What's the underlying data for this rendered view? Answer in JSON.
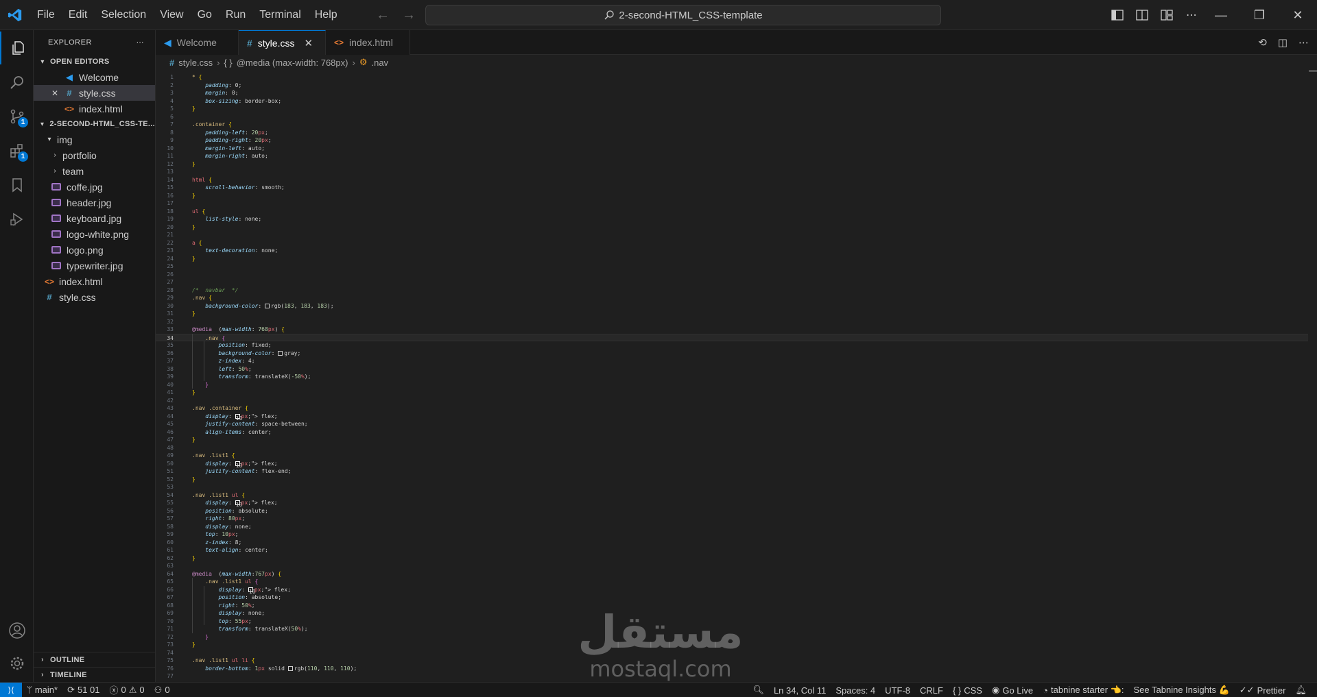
{
  "menu": [
    "File",
    "Edit",
    "Selection",
    "View",
    "Go",
    "Run",
    "Terminal",
    "Help"
  ],
  "command_center": {
    "text": "2-second-HTML_CSS-template"
  },
  "explorer": {
    "title": "EXPLORER",
    "open_editors_label": "OPEN EDITORS",
    "open_editors": [
      {
        "name": "Welcome",
        "icon": "vscode-icon"
      },
      {
        "name": "style.css",
        "icon": "css-icon",
        "close": "✕"
      },
      {
        "name": "index.html",
        "icon": "html-icon"
      }
    ],
    "project_label": "2-SECOND-HTML_CSS-TE...",
    "tree": [
      {
        "name": "img",
        "kind": "folder-open"
      },
      {
        "name": "portfolio",
        "kind": "folder"
      },
      {
        "name": "team",
        "kind": "folder"
      },
      {
        "name": "coffe.jpg",
        "kind": "image"
      },
      {
        "name": "header.jpg",
        "kind": "image"
      },
      {
        "name": "keyboard.jpg",
        "kind": "image"
      },
      {
        "name": "logo-white.png",
        "kind": "image"
      },
      {
        "name": "logo.png",
        "kind": "image"
      },
      {
        "name": "typewriter.jpg",
        "kind": "image"
      },
      {
        "name": "index.html",
        "kind": "html"
      },
      {
        "name": "style.css",
        "kind": "css"
      }
    ],
    "outline_label": "OUTLINE",
    "timeline_label": "TIMELINE"
  },
  "badges": {
    "source_control": "1",
    "extensions": "1"
  },
  "tabs": [
    {
      "label": "Welcome",
      "icon": "vscode-icon"
    },
    {
      "label": "style.css",
      "icon": "css-icon",
      "close": "✕"
    },
    {
      "label": "index.html",
      "icon": "html-icon"
    }
  ],
  "breadcrumb": {
    "file": "style.css",
    "media": "@media (max-width: 768px)",
    "symbol": ".nav"
  },
  "code": [
    "* {",
    "    padding: 0;",
    "    margin: 0;",
    "    box-sizing: border-box;",
    "}",
    "",
    ".container {",
    "    padding-left: 20px;",
    "    padding-right: 20px;",
    "    margin-left: auto;",
    "    margin-right: auto;",
    "}",
    "",
    "html {",
    "    scroll-behavior: smooth;",
    "}",
    "",
    "ul {",
    "    list-style: none;",
    "}",
    "",
    "a {",
    "    text-decoration: none;",
    "}",
    "",
    "",
    "",
    "/*  navbar  */",
    ".nav {",
    "    background-color: ▢rgb(183, 183, 183);",
    "}",
    "",
    "@media (max-width: 768px) {",
    "    .nav {",
    "        position: fixed;",
    "        background-color: ▢gray;",
    "        z-index: 4;",
    "        left: 50%;",
    "        transform: translateX(-50%);",
    "    }",
    "}",
    "",
    ".nav .container {",
    "    display: ▣ flex;",
    "    justify-content: space-between;",
    "    align-items: center;",
    "}",
    "",
    ".nav .list1 {",
    "    display: ▣ flex;",
    "    justify-content: flex-end;",
    "}",
    "",
    ".nav .list1 ul {",
    "    display: ▣ flex;",
    "    position: absolute;",
    "    right: 80px;",
    "    display: none;",
    "    top: 10px;",
    "    z-index: 8;",
    "    text-align: center;",
    "}",
    "",
    "@media (max-width:767px) {",
    "    .nav .list1 ul {",
    "        display: ▣ flex;",
    "        position: absolute;",
    "        right: 50%;",
    "        display: none;",
    "        top: 55px;",
    "        transform: translateX(50%);",
    "    }",
    "}",
    "",
    ".nav .list1 ul li {",
    "    border-bottom: 1px solid ▢rgb(110, 110, 110);",
    "",
    "}"
  ],
  "current_line": 34,
  "watermark": {
    "arabic": "مستقل",
    "latin": "mostaql.com"
  },
  "status": {
    "branch": "main*",
    "sync": "51 01",
    "errors": "0",
    "warnings": "0",
    "ports": "0",
    "position": "Ln 34, Col 11",
    "spaces": "Spaces: 4",
    "encoding": "UTF-8",
    "eol": "CRLF",
    "language": "CSS",
    "golive": "Go Live",
    "tabnine": "tabnine starter 👈:",
    "tabnine_insights": "See Tabnine Insights 💪",
    "prettier": "Prettier"
  }
}
